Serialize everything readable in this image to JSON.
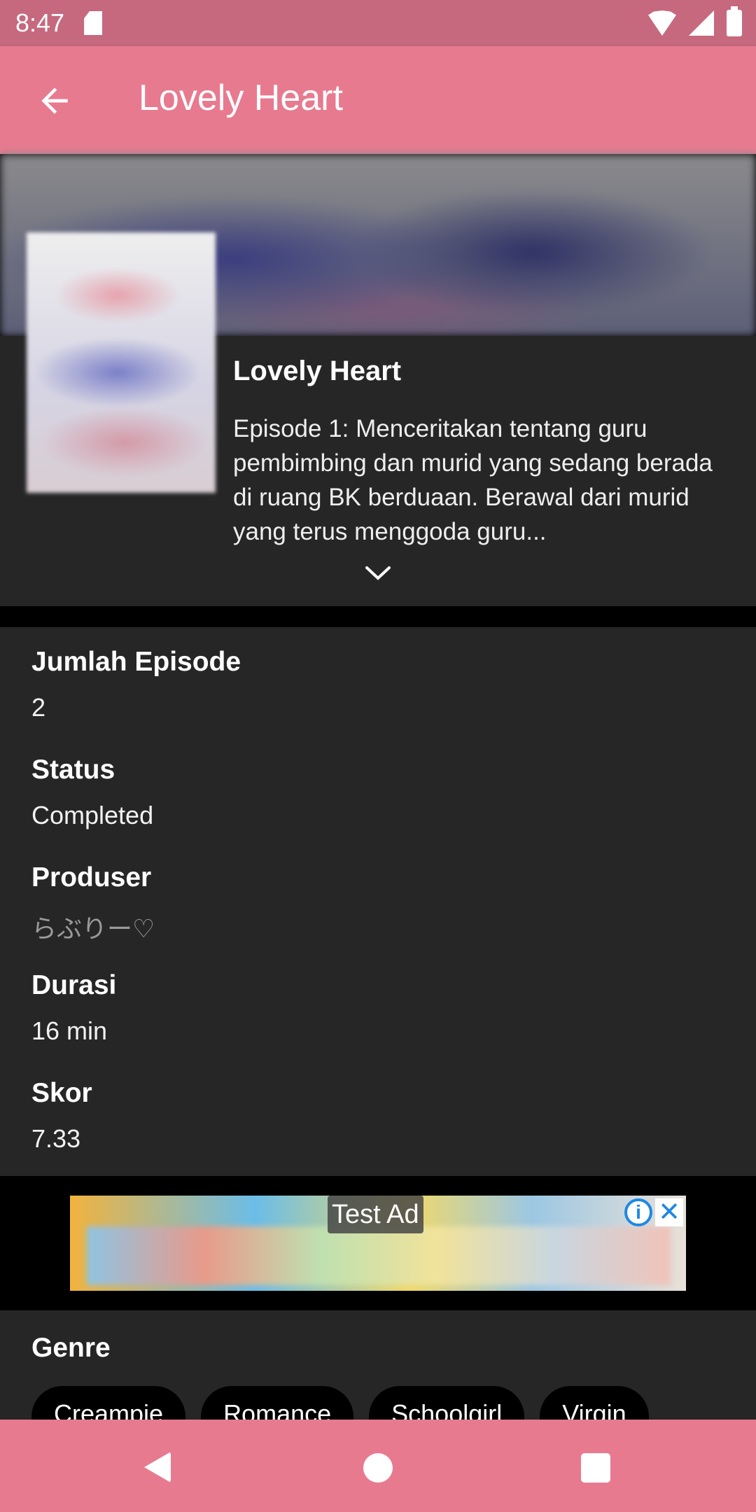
{
  "status_bar": {
    "time": "8:47"
  },
  "app_bar": {
    "title": "Lovely Heart"
  },
  "anime": {
    "title": "Lovely Heart",
    "synopsis": "Episode 1: Menceritakan tentang guru pembimbing dan murid yang sedang berada di ruang BK berduaan. Berawal dari murid yang terus menggoda guru..."
  },
  "details": {
    "episodes": {
      "label": "Jumlah Episode",
      "value": "2"
    },
    "status": {
      "label": "Status",
      "value": "Completed"
    },
    "producer": {
      "label": "Produser",
      "value": "らぶりー♡"
    },
    "duration": {
      "label": "Durasi",
      "value": "16 min"
    },
    "score": {
      "label": "Skor",
      "value": "7.33"
    }
  },
  "ad": {
    "label": "Test Ad"
  },
  "genre": {
    "label": "Genre",
    "chips": [
      "Creampie",
      "Romance",
      "Schoolgirl",
      "Virgin"
    ]
  },
  "colors": {
    "primary": "#e87a90",
    "status_bar": "#c6697e",
    "card": "#262626"
  },
  "icons": {
    "back": "arrow-left-icon",
    "expand": "chevron-down-icon",
    "ad_info": "info-icon",
    "ad_close": "close-icon"
  }
}
